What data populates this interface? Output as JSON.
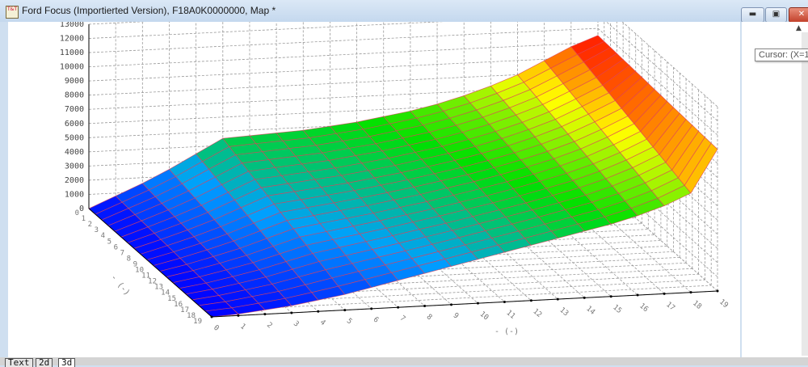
{
  "window": {
    "title": "Ford Focus (Importierted Version), F18A0K0000000, Map *",
    "minimize_icon": "minimize-icon",
    "maximize_icon": "restore-icon",
    "close_icon": "close-icon"
  },
  "tooltip": {
    "text": "Cursor: (X=1"
  },
  "tabs": [
    {
      "label": "Text"
    },
    {
      "label": "2d"
    },
    {
      "label": "3d"
    }
  ],
  "chart_data": {
    "type": "surface3d",
    "x_label": "- (-)",
    "y_label": "- (-)",
    "x_ticks": [
      "0",
      "1",
      "2",
      "3",
      "4",
      "5",
      "6",
      "7",
      "8",
      "9",
      "10",
      "11",
      "12",
      "13",
      "14",
      "15",
      "16",
      "17",
      "18",
      "19"
    ],
    "y_ticks": [
      "0",
      "1",
      "2",
      "3",
      "4",
      "5",
      "6",
      "7",
      "8",
      "9",
      "10",
      "11",
      "12",
      "13",
      "14",
      "15",
      "16",
      "17",
      "18",
      "19"
    ],
    "z_ticks": [
      "0",
      "1000",
      "2000",
      "3000",
      "4000",
      "5000",
      "6000",
      "7000",
      "8000",
      "9000",
      "10000",
      "11000",
      "12000",
      "13000"
    ],
    "z_range": [
      0,
      13000
    ],
    "grid": true,
    "colormap": [
      "#0000ff",
      "#00a0ff",
      "#00e000",
      "#ffff00",
      "#ff0000"
    ],
    "z": [
      [
        0,
        800,
        1600,
        2500,
        3500,
        4500,
        4600,
        4700,
        4800,
        5000,
        5200,
        5500,
        5800,
        6200,
        6700,
        7300,
        8000,
        8900,
        9800,
        10500
      ],
      [
        0,
        760,
        1530,
        2390,
        3360,
        4320,
        4440,
        4550,
        4670,
        4880,
        5090,
        5390,
        5700,
        6100,
        6590,
        7180,
        7870,
        8760,
        9650,
        10470
      ],
      [
        0,
        730,
        1460,
        2290,
        3220,
        4140,
        4270,
        4410,
        4540,
        4760,
        4980,
        5290,
        5600,
        6000,
        6490,
        7070,
        7750,
        8620,
        9510,
        10450
      ],
      [
        0,
        690,
        1390,
        2180,
        3070,
        3960,
        4110,
        4260,
        4410,
        4640,
        4870,
        5180,
        5500,
        5900,
        6380,
        6950,
        7620,
        8470,
        9360,
        10420
      ],
      [
        0,
        650,
        1330,
        2080,
        2930,
        3780,
        3950,
        4110,
        4270,
        4520,
        4760,
        5080,
        5400,
        5800,
        6280,
        6840,
        7490,
        8330,
        9210,
        10390
      ],
      [
        0,
        620,
        1260,
        1970,
        2790,
        3610,
        3780,
        3960,
        4140,
        4390,
        4650,
        4970,
        5300,
        5700,
        6170,
        6720,
        7370,
        8190,
        9060,
        10370
      ],
      [
        0,
        580,
        1190,
        1870,
        2650,
        3430,
        3620,
        3820,
        4010,
        4270,
        4540,
        4870,
        5200,
        5600,
        6070,
        6610,
        7240,
        8050,
        8920,
        10340
      ],
      [
        0,
        540,
        1120,
        1760,
        2510,
        3250,
        3460,
        3670,
        3880,
        4150,
        4430,
        4760,
        5100,
        5500,
        5960,
        6490,
        7120,
        7910,
        8770,
        10320
      ],
      [
        0,
        510,
        1050,
        1660,
        2360,
        3070,
        3290,
        3520,
        3750,
        4030,
        4320,
        4660,
        5000,
        5400,
        5860,
        6370,
        6990,
        7760,
        8620,
        10290
      ],
      [
        0,
        470,
        980,
        1550,
        2220,
        2890,
        3130,
        3370,
        3620,
        3910,
        4210,
        4550,
        4900,
        5300,
        5750,
        6260,
        6860,
        7620,
        8470,
        10260
      ],
      [
        0,
        430,
        920,
        1450,
        2080,
        2710,
        2970,
        3230,
        3480,
        3790,
        4090,
        4450,
        4800,
        5200,
        5650,
        6140,
        6740,
        7480,
        8330,
        10240
      ],
      [
        0,
        390,
        850,
        1340,
        1940,
        2530,
        2810,
        3080,
        3350,
        3670,
        3980,
        4340,
        4700,
        5100,
        5540,
        6030,
        6610,
        7340,
        8180,
        10210
      ],
      [
        0,
        360,
        780,
        1240,
        1790,
        2350,
        2640,
        2930,
        3220,
        3550,
        3870,
        4240,
        4600,
        5000,
        5440,
        5910,
        6480,
        7190,
        8030,
        10180
      ],
      [
        0,
        320,
        710,
        1130,
        1650,
        2170,
        2480,
        2780,
        3090,
        3430,
        3760,
        4130,
        4500,
        4900,
        5330,
        5790,
        6360,
        7050,
        7880,
        10160
      ],
      [
        0,
        280,
        640,
        1030,
        1510,
        1990,
        2320,
        2640,
        2960,
        3310,
        3650,
        4030,
        4400,
        4800,
        5230,
        5680,
        6230,
        6910,
        7740,
        10130
      ],
      [
        0,
        250,
        570,
        920,
        1370,
        1820,
        2150,
        2490,
        2830,
        3180,
        3540,
        3920,
        4300,
        4700,
        5120,
        5560,
        6110,
        6770,
        7590,
        10110
      ],
      [
        0,
        210,
        510,
        820,
        1230,
        1640,
        1990,
        2340,
        2690,
        3060,
        3430,
        3820,
        4200,
        4600,
        5020,
        5450,
        5980,
        6630,
        7440,
        10080
      ],
      [
        0,
        170,
        440,
        710,
        1080,
        1460,
        1830,
        2190,
        2560,
        2940,
        3320,
        3710,
        4100,
        4500,
        4910,
        5330,
        5850,
        6480,
        7290,
        10050
      ],
      [
        0,
        140,
        370,
        610,
        940,
        1280,
        1660,
        2050,
        2430,
        2820,
        3210,
        3610,
        4000,
        4400,
        4810,
        5220,
        5730,
        6340,
        7150,
        10030
      ],
      [
        0,
        100,
        300,
        500,
        800,
        1100,
        1500,
        1900,
        2300,
        2700,
        3100,
        3500,
        3900,
        4300,
        4700,
        5100,
        5600,
        6200,
        7000,
        10000
      ]
    ]
  }
}
